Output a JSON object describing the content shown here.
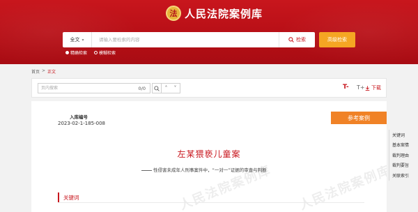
{
  "header": {
    "title": "人民法院案例库",
    "emblem_glyph": "法"
  },
  "search": {
    "scope_label": "全文",
    "placeholder": "请输入要检索的内容",
    "search_button_label": "检索",
    "advanced_button_label": "高级检索",
    "modes": [
      {
        "label": "精确检索",
        "selected": true
      },
      {
        "label": "模糊检索",
        "selected": false
      }
    ]
  },
  "breadcrumb": {
    "home": "首页",
    "separator": ">",
    "current": "正文"
  },
  "toolbar": {
    "find_placeholder": "页内搜索",
    "find_count": "0/0",
    "font_increase_label": "T-",
    "font_decrease_label": "T+",
    "download_label": "下载"
  },
  "case": {
    "entry_label": "入库编号",
    "entry_number": "2023-02-1-185-008",
    "reference_tag": "参考案例",
    "title": "左某猥亵儿童案",
    "subtitle": "性侵害未成年人刑事案件中，“一对一”证据的审查与判断",
    "watermark": "人民法院案例库",
    "first_section": "关键词"
  },
  "side_nav": {
    "items": [
      "关键词",
      "基本案情",
      "裁判理由",
      "裁判要旨",
      "关联索引"
    ]
  },
  "colors": {
    "brand_red": "#c8161d",
    "accent_orange": "#f5a623",
    "tag_orange": "#f08226"
  }
}
